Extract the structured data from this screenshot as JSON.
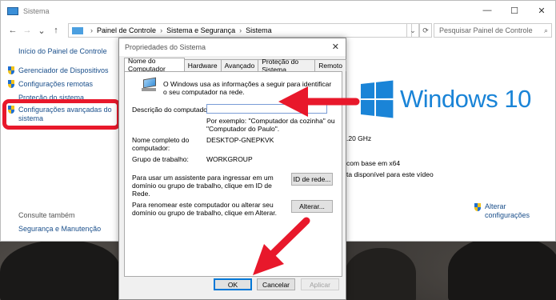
{
  "window": {
    "title": "Sistema",
    "controls": [
      "—",
      "☐",
      "✕"
    ]
  },
  "nav": {
    "back": "←",
    "forward": "→",
    "recent": "⌄",
    "up": "↑",
    "breadcrumb": [
      "Painel de Controle",
      "Sistema e Segurança",
      "Sistema"
    ],
    "breadcrumb_sep": "›",
    "dropdown": "⌄",
    "refresh": "⟳",
    "search_placeholder": "Pesquisar Painel de Controle",
    "search_icon": "⌕"
  },
  "sidebar": {
    "home": "Início do Painel de Controle",
    "items": [
      {
        "label": "Gerenciador de Dispositivos"
      },
      {
        "label": "Configurações remotas"
      },
      {
        "label": "Proteção do sistema"
      },
      {
        "label": "Configurações avançadas do sistema"
      }
    ],
    "see_also_heading": "Consulte também",
    "see_also_link": "Segurança e Manutenção"
  },
  "main": {
    "brand_text": "Windows 10",
    "cpu_suffix": ".20 GHz",
    "system_type": "com base em x64",
    "pen_touch": "ta disponível para este vídeo",
    "change_settings": "Alterar configurações"
  },
  "dialog": {
    "title": "Propriedades do Sistema",
    "close": "✕",
    "tabs": [
      "Nome do Computador",
      "Hardware",
      "Avançado",
      "Proteção do Sistema",
      "Remoto"
    ],
    "intro": "O Windows usa as informações a seguir para identificar o seu computador na rede.",
    "description_label": "Descrição do computador:",
    "description_value": "",
    "example": "Por exemplo: \"Computador da cozinha\" ou \"Computador do Paulo\".",
    "full_name_label": "Nome completo do computador:",
    "full_name_value": "DESKTOP-GNEPKVK",
    "workgroup_label": "Grupo de trabalho:",
    "workgroup_value": "WORKGROUP",
    "network_id_text": "Para usar um assistente para ingressar em um domínio ou grupo de trabalho, clique em ID de Rede.",
    "network_id_button": "ID de rede...",
    "rename_text": "Para renomear este computador ou alterar seu domínio ou grupo de trabalho, clique em Alterar.",
    "change_button": "Alterar...",
    "ok_button": "OK",
    "cancel_button": "Cancelar",
    "apply_button": "Aplicar"
  },
  "colors": {
    "annotation_red": "#e8182b",
    "windows_blue": "#1a84d7",
    "link_blue": "#1a4f8b"
  }
}
